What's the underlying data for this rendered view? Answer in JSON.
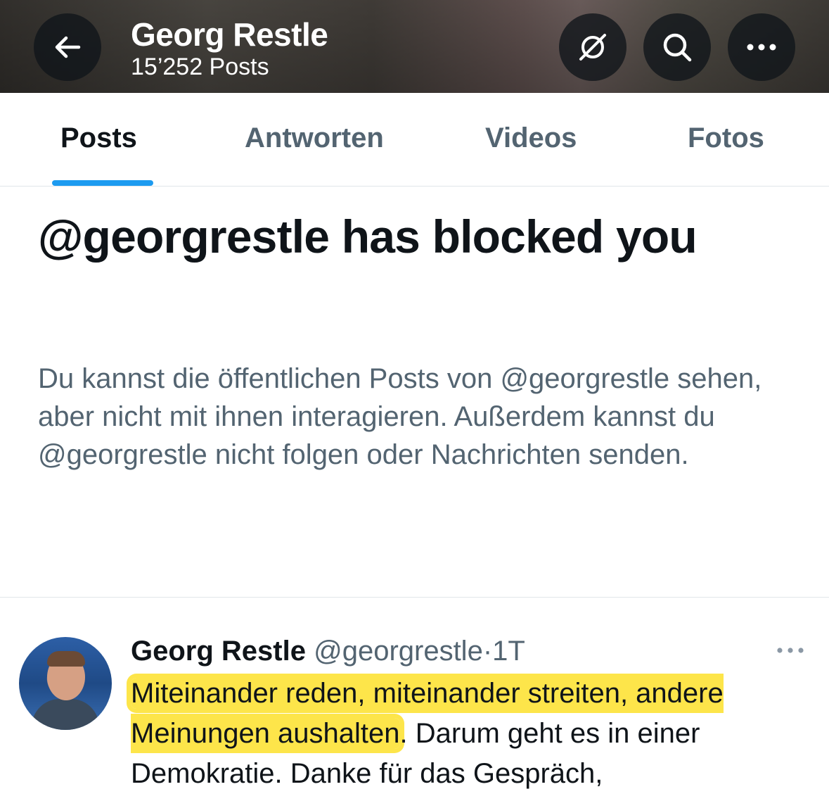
{
  "header": {
    "title": "Georg Restle",
    "post_count": "15’252 Posts",
    "icons": [
      "back-arrow-icon",
      "translate-icon",
      "search-icon",
      "more-icon"
    ]
  },
  "tabs": [
    {
      "label": "Posts",
      "active": true
    },
    {
      "label": "Antworten",
      "active": false
    },
    {
      "label": "Videos",
      "active": false
    },
    {
      "label": "Fotos",
      "active": false
    }
  ],
  "blocked": {
    "title": "@georgrestle has blocked you",
    "description": "Du kannst die öffentlichen Posts von @georgrestle sehen, aber nicht mit ihnen interagieren. Außerdem kannst du @georgrestle nicht folgen oder Nachrichten senden."
  },
  "post": {
    "author_name": "Georg Restle",
    "author_handle": "@georgrestle",
    "separator": "·",
    "time": "1T",
    "text_highlighted": "Miteinander reden, miteinander streiten, andere Meinungen aushalten",
    "text_rest": ". Darum geht es in einer Demokratie. Danke für das Gespräch,",
    "highlight_color": "#fde54a"
  },
  "colors": {
    "accent": "#1d9bf0",
    "secondary_text": "#536471",
    "primary_text": "#0f1419"
  }
}
